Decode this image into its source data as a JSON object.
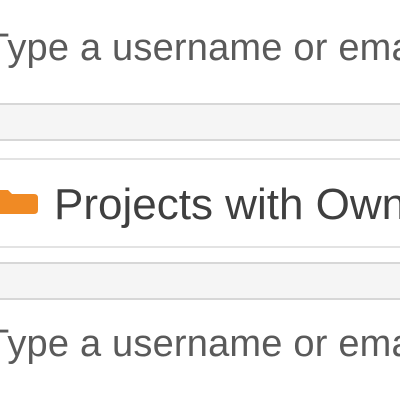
{
  "user_search": {
    "placeholder_text": "Type a username or email"
  },
  "project_row": {
    "label": "Projects with Owner access",
    "icon": "folder-icon",
    "icon_color": "#f08a24"
  },
  "user_search_secondary": {
    "placeholder_text": "Type a username or email"
  }
}
